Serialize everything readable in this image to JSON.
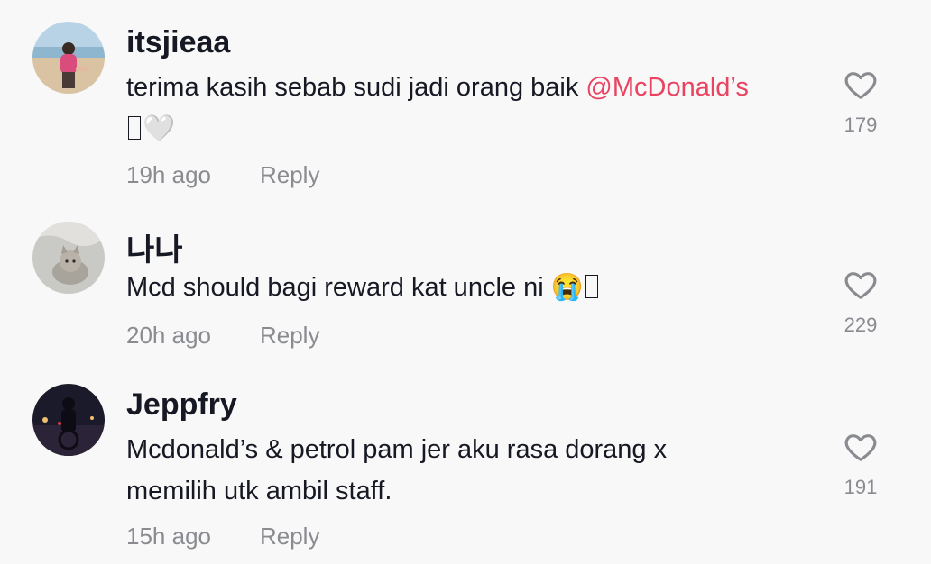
{
  "comments": [
    {
      "username": "itsjieaa",
      "text_main": "terima kasih sebab sudi jadi orang baik ",
      "mention": "@McDonald’s",
      "text_line2_emoji": "🤍",
      "time": "19h ago",
      "reply_label": "Reply",
      "likes": "179"
    },
    {
      "username": "나나",
      "text_main": "Mcd should bagi reward kat uncle ni ",
      "emoji": "😭",
      "time": "20h ago",
      "reply_label": "Reply",
      "likes": "229"
    },
    {
      "username": "Jeppfry",
      "text_main": "Mcdonald’s & petrol pam jer aku rasa dorang x memilih utk ambil staff.",
      "time": "15h ago",
      "reply_label": "Reply",
      "likes": "191"
    }
  ],
  "colors": {
    "background": "#f8f8f8",
    "mention": "#ea4361",
    "meta": "#8a8b91",
    "text": "#161823"
  },
  "icons": {
    "like": "heart-outline-icon"
  }
}
